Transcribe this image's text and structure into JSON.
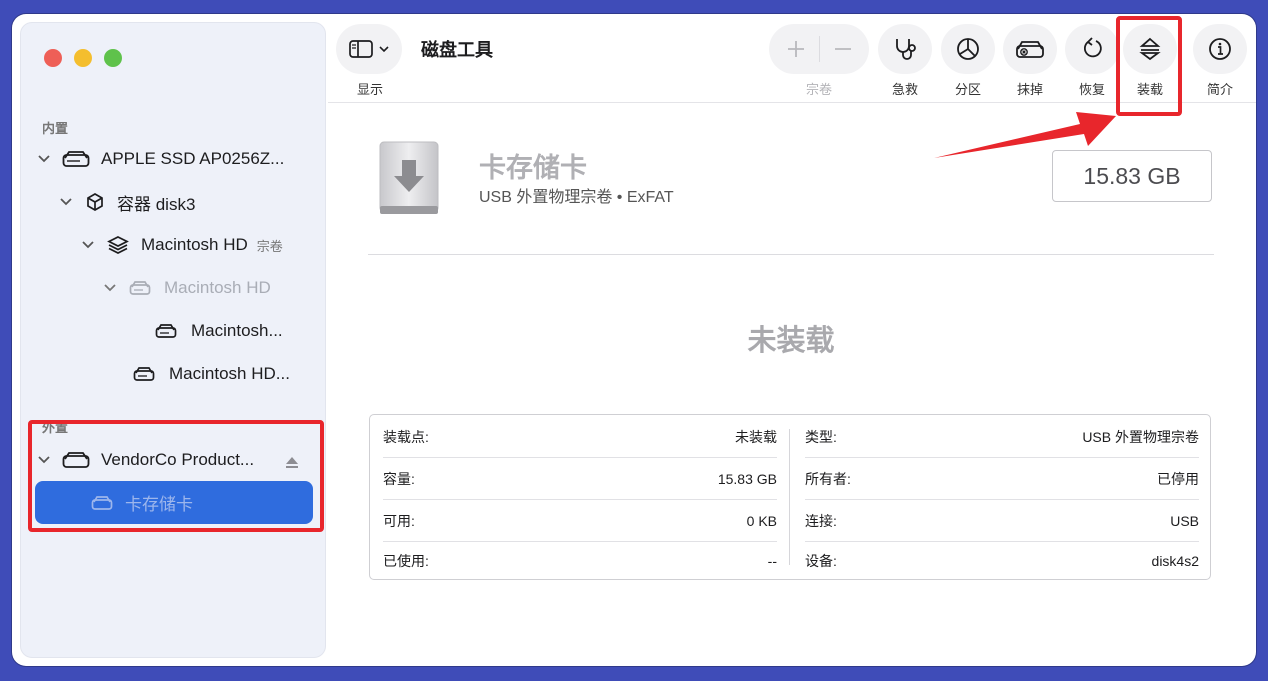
{
  "app": {
    "title": "磁盘工具"
  },
  "sidebar": {
    "section_internal": "内置",
    "section_external": "外置",
    "items": [
      {
        "label": "APPLE SSD AP0256Z..."
      },
      {
        "label": "容器 disk3"
      },
      {
        "label": "Macintosh HD",
        "badge": "宗卷"
      },
      {
        "label": "Macintosh HD"
      },
      {
        "label": "Macintosh..."
      },
      {
        "label": "Macintosh HD..."
      },
      {
        "label": "VendorCo Product..."
      },
      {
        "label": "卡存储卡"
      }
    ]
  },
  "toolbar": {
    "view_label": "显示",
    "volume_label": "宗卷",
    "first_aid_label": "急救",
    "partition_label": "分区",
    "erase_label": "抹掉",
    "restore_label": "恢复",
    "mount_label": "装载",
    "info_label": "简介"
  },
  "volume": {
    "name": "卡存储卡",
    "subtitle": "USB 外置物理宗卷 • ExFAT",
    "size": "15.83 GB",
    "status": "未装载"
  },
  "info": {
    "left": [
      {
        "key": "装载点:",
        "value": "未装载"
      },
      {
        "key": "容量:",
        "value": "15.83 GB"
      },
      {
        "key": "可用:",
        "value": "0 KB"
      },
      {
        "key": "已使用:",
        "value": "--"
      }
    ],
    "right": [
      {
        "key": "类型:",
        "value": "USB 外置物理宗卷"
      },
      {
        "key": "所有者:",
        "value": "已停用"
      },
      {
        "key": "连接:",
        "value": "USB"
      },
      {
        "key": "设备:",
        "value": "disk4s2"
      }
    ]
  },
  "colors": {
    "background": "#3f4cb8",
    "selection": "#2f6cde",
    "annotation_red": "#e8262c"
  }
}
